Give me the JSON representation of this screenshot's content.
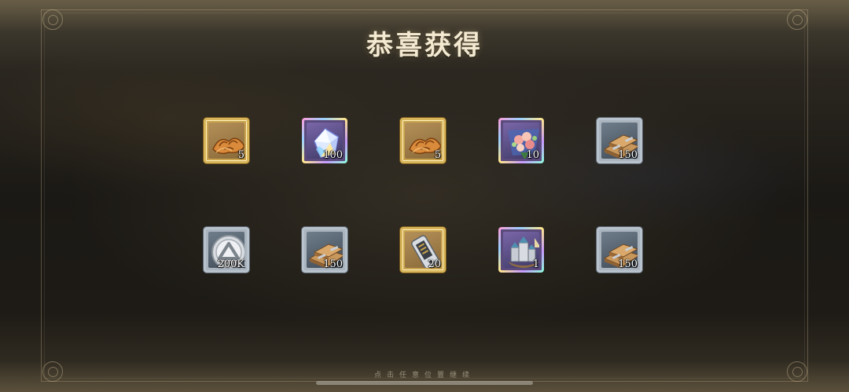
{
  "title": "恭喜获得",
  "hint": "点击任意位置继续",
  "rewards": [
    {
      "icon": "croissant-icon",
      "rarity": "gold",
      "quantity": "5"
    },
    {
      "icon": "crystal-icon",
      "rarity": "rainbow",
      "quantity": "100"
    },
    {
      "icon": "croissant-icon",
      "rarity": "gold",
      "quantity": "5"
    },
    {
      "icon": "flower-bouquet-icon",
      "rarity": "rainbow",
      "quantity": "10"
    },
    {
      "icon": "wood-planks-icon",
      "rarity": "silver",
      "quantity": "150"
    },
    {
      "icon": "silver-coin-icon",
      "rarity": "silver",
      "quantity": "200K"
    },
    {
      "icon": "wood-planks-icon",
      "rarity": "silver",
      "quantity": "150"
    },
    {
      "icon": "ticket-device-icon",
      "rarity": "gold",
      "quantity": "20"
    },
    {
      "icon": "castle-ship-icon",
      "rarity": "rainbow",
      "quantity": "1"
    },
    {
      "icon": "wood-planks-icon",
      "rarity": "silver",
      "quantity": "150"
    }
  ]
}
